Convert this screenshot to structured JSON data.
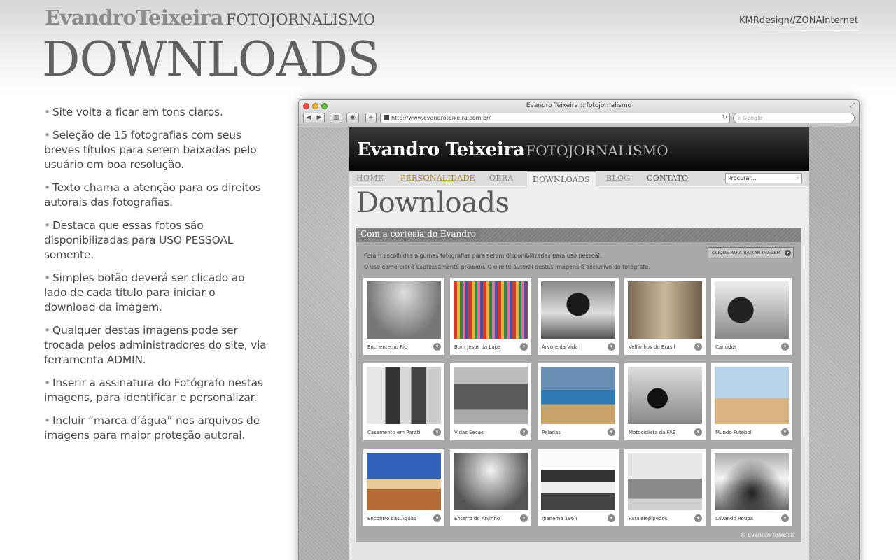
{
  "slide": {
    "brand_name": "EvandroTeixeira",
    "brand_sub": "FOTOJORNALISMO",
    "credit": "KMRdesign//ZONAInternet",
    "title": "DOWNLOADS"
  },
  "bullets": [
    "Site volta a ficar em tons claros.",
    "Seleção de 15 fotografias com seus breves títulos para serem baixadas pelo usuário em boa resolução.",
    "Texto chama a atenção para os direitos autorais das fotografias.",
    "Destaca que essas fotos são disponibilizadas para USO PESSOAL somente.",
    "Simples botão deverá ser clicado ao lado de cada título para iniciar o download da imagem.",
    "Qualquer destas imagens pode ser trocada pelos administradores do site, via ferramenta ADMIN.",
    "Inserir a assinatura do Fotógrafo nestas imagens, para identificar e personalizar.",
    "Incluir “marca d’água” nos arquivos de imagens para maior proteção autoral."
  ],
  "browser": {
    "window_title": "Evandro Teixeira :: fotojornalismo",
    "url": "http://www.evandroteixeira.com.br/",
    "search_placeholder": "Google"
  },
  "site": {
    "logo_name": "Evandro Teixeira",
    "logo_sub": "FOTOJORNALISMO",
    "nav": [
      "HOME",
      "PERSONALIDADE",
      "OBRA",
      "DOWNLOADS",
      "BLOG",
      "CONTATO"
    ],
    "search_placeholder": "Procurar...",
    "heading": "Downloads",
    "panel_title": "Com a cortesia do Evandro",
    "intro_line1": "Foram escolhidas algumas fotografias para serem disponibilizadas para uso pessoal.",
    "intro_line2": "O uso comercial é expressamente proibido. O direito autoral destas imagens é exclusivo do fotógrafo.",
    "download_hint": "CLIQUE PARA BAIXAR IMAGEM",
    "photos": [
      "Enchente no Rio",
      "Bom Jesus da Lapa",
      "Árvore da Vida",
      "Velhinhos do Brasil",
      "Canudos",
      "Casamento em Parati",
      "Vidas Secas",
      "Peladas",
      "Motociclista da FAB",
      "Mundo Futebol",
      "Encontro das Águas",
      "Enterro do Anjinho",
      "Ipanema 1964",
      "Paralelepípedos",
      "Lavando Roupa"
    ],
    "copyright": "© Evandro Teixeira"
  }
}
